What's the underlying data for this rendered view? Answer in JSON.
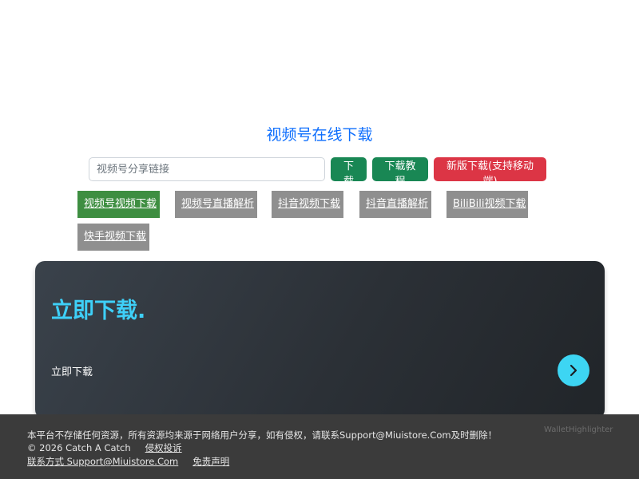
{
  "title": "视频号在线下载",
  "search": {
    "placeholder": "视频号分享链接",
    "download_label": "下载",
    "tutorial_label": "下载教程",
    "new_version_label": "新版下载(支持移动端)"
  },
  "nav": {
    "items": [
      {
        "label": "视频号视频下载",
        "active": true
      },
      {
        "label": "视频号直播解析",
        "active": false
      },
      {
        "label": "抖音视频下载",
        "active": false
      },
      {
        "label": "抖音直播解析",
        "active": false
      },
      {
        "label": "BiliBili视频下载",
        "active": false
      },
      {
        "label": "快手视频下载",
        "active": false
      }
    ]
  },
  "hero": {
    "title": "立即下载.",
    "subtitle": "立即下载",
    "arrow_icon": "chevron-right-icon"
  },
  "footer": {
    "disclaimer": "本平台不存储任何资源，所有资源均来源于网络用户分享，如有侵权，请联系Support@Miuistore.Com及时删除！",
    "copyright": "© 2026 Catch A Catch",
    "complaint_link": "侵权投诉",
    "contact_link": "联系方式 Support@Miuistore.Com",
    "disclaimer_link": "免责声明"
  },
  "watermark": "WalletHighlighter",
  "colors": {
    "title": "#0d6efd",
    "green": "#198754",
    "red": "#dc3545",
    "nav_active": "#3e8e41",
    "nav_inactive": "#8f8f8f",
    "hero_accent": "#3ed0f8",
    "footer_bg": "#3b3b3b"
  }
}
